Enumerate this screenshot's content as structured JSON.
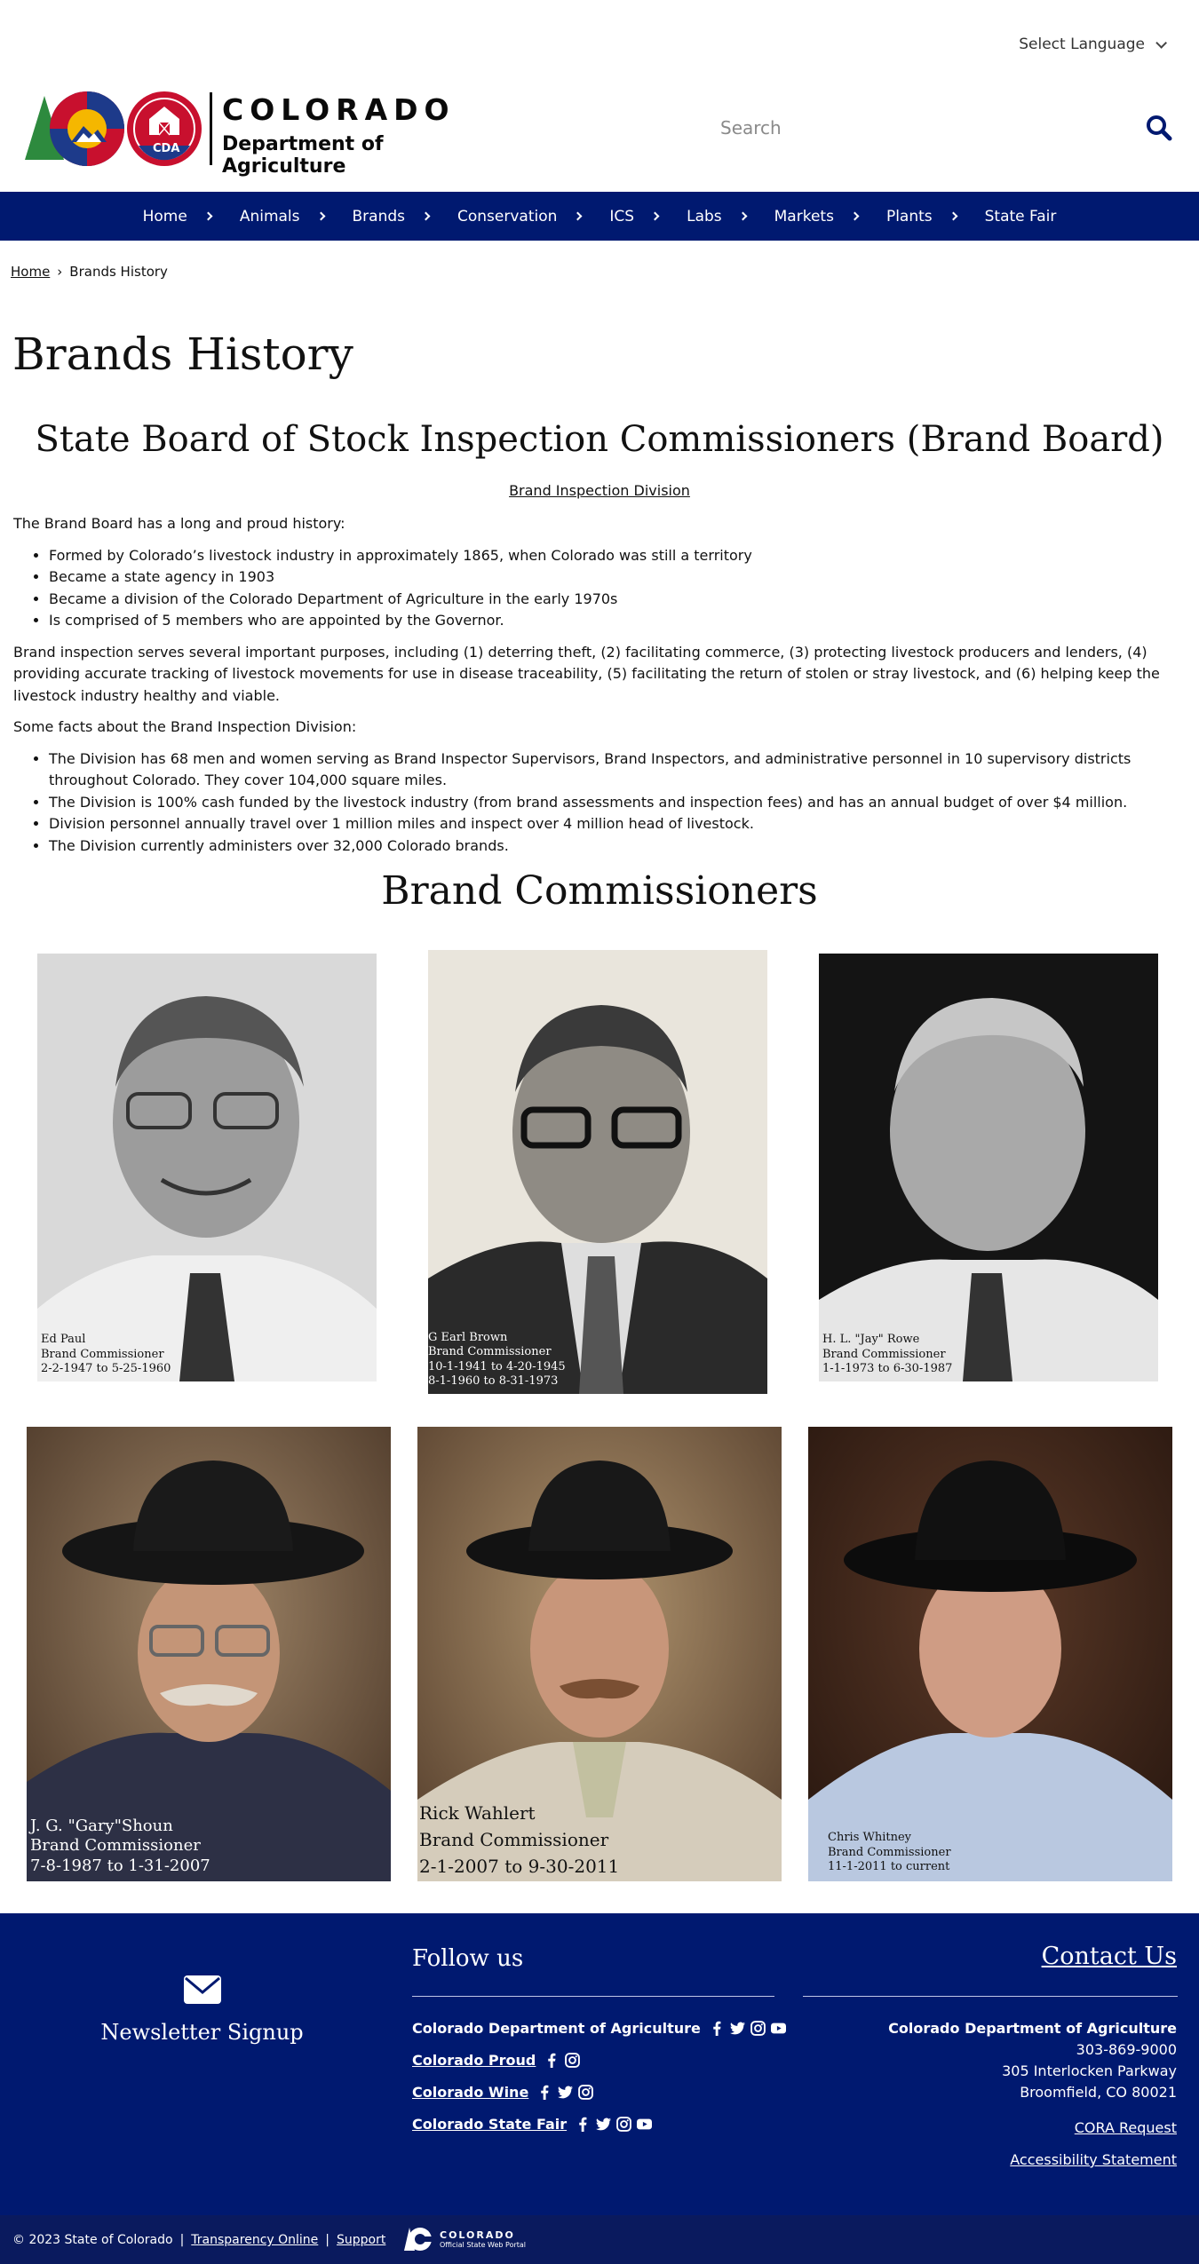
{
  "header": {
    "language_label": "Select Language",
    "logo": {
      "wordmark_top": "COLORADO",
      "wordmark_bottom": "Department of Agriculture",
      "badge_text": "CDA"
    },
    "search_placeholder": "Search"
  },
  "nav": {
    "items": [
      {
        "label": "Home"
      },
      {
        "label": "Animals"
      },
      {
        "label": "Brands"
      },
      {
        "label": "Conservation"
      },
      {
        "label": "ICS"
      },
      {
        "label": "Labs"
      },
      {
        "label": "Markets"
      },
      {
        "label": "Plants"
      },
      {
        "label": "State Fair"
      }
    ]
  },
  "breadcrumb": {
    "home": "Home",
    "separator": "›",
    "current": "Brands History"
  },
  "page": {
    "title": "Brands History",
    "board_title": "State Board of Stock Inspection Commissioners (Brand Board)",
    "division_link": "Brand Inspection Division",
    "intro": "The Brand Board has a long and proud history:",
    "history_items": [
      "Formed by Colorado’s livestock industry in approximately 1865, when Colorado was still a territory",
      "Became a state agency in 1903",
      "Became a division of the Colorado Department of Agriculture in the early 1970s",
      "Is comprised of 5 members who are appointed by the Governor."
    ],
    "purposes": "Brand inspection serves several important purposes, including (1) deterring theft, (2) facilitating commerce, (3) protecting livestock producers and lenders, (4) providing accurate tracking of livestock movements for use in disease traceability, (5) facilitating the return of stolen or stray livestock, and (6) helping keep the livestock industry healthy and viable.",
    "facts_intro": "Some facts about the Brand Inspection Division:",
    "facts_items": [
      "The Division has 68 men and women serving as Brand Inspector Supervisors, Brand Inspectors, and administrative personnel in 10 supervisory districts throughout Colorado. They cover 104,000 square miles.",
      "The Division is 100% cash funded by the livestock industry (from brand assessments and inspection fees) and has an annual budget of over $4 million.",
      "Division personnel annually travel over 1 million miles and inspect over 4 million head of livestock.",
      "The Division currently administers over 32,000 Colorado brands."
    ],
    "commissioners_title": "Brand Commissioners"
  },
  "commissioners": [
    {
      "lines": [
        "Ed Paul",
        "Brand Commissioner",
        "2-2-1947 to 5-25-1960"
      ]
    },
    {
      "lines": [
        "G Earl Brown",
        "Brand Commissioner",
        "10-1-1941 to 4-20-1945",
        "8-1-1960 to 8-31-1973"
      ]
    },
    {
      "lines": [
        "H. L. \"Jay\" Rowe",
        "Brand Commissioner",
        "1-1-1973 to 6-30-1987"
      ]
    },
    {
      "lines": [
        "J. G. \"Gary\"Shoun",
        "Brand Commissioner",
        "7-8-1987 to 1-31-2007"
      ]
    },
    {
      "lines": [
        "Rick Wahlert",
        "Brand Commissioner",
        "2-1-2007 to 9-30-2011"
      ]
    },
    {
      "lines": [
        "Chris Whitney",
        "Brand Commissioner",
        "11-1-2011 to current"
      ]
    }
  ],
  "footer": {
    "newsletter_label": "Newsletter Signup",
    "follow_title": "Follow us",
    "social": [
      {
        "name": "Colorado Department of Agriculture",
        "icons": [
          "facebook-icon",
          "twitter-icon",
          "instagram-icon",
          "youtube-icon"
        ]
      },
      {
        "name": "Colorado Proud",
        "icons": [
          "facebook-icon",
          "instagram-icon"
        ]
      },
      {
        "name": "Colorado Wine",
        "icons": [
          "facebook-icon",
          "twitter-icon",
          "instagram-icon"
        ]
      },
      {
        "name": "Colorado State Fair",
        "icons": [
          "facebook-icon",
          "twitter-icon",
          "instagram-icon",
          "youtube-icon"
        ]
      }
    ],
    "contact_title": "Contact Us",
    "org_name": "Colorado Department of Agriculture",
    "phone": "303-869-9000",
    "street": "305 Interlocken Parkway",
    "city": "Broomfield, CO 80021",
    "cora": "CORA Request",
    "accessibility": "Accessibility Statement"
  },
  "subfooter": {
    "copyright": "© 2023 State of Colorado",
    "sep": "|",
    "transparency": "Transparency Online",
    "support": "Support",
    "portal_line1": "COLORADO",
    "portal_line2": "Official State Web Portal"
  },
  "colors": {
    "nav_bg": "#001970",
    "footer_bg": "#001970",
    "subfooter_bg": "#0a1a5e",
    "search_icon": "#001970"
  }
}
